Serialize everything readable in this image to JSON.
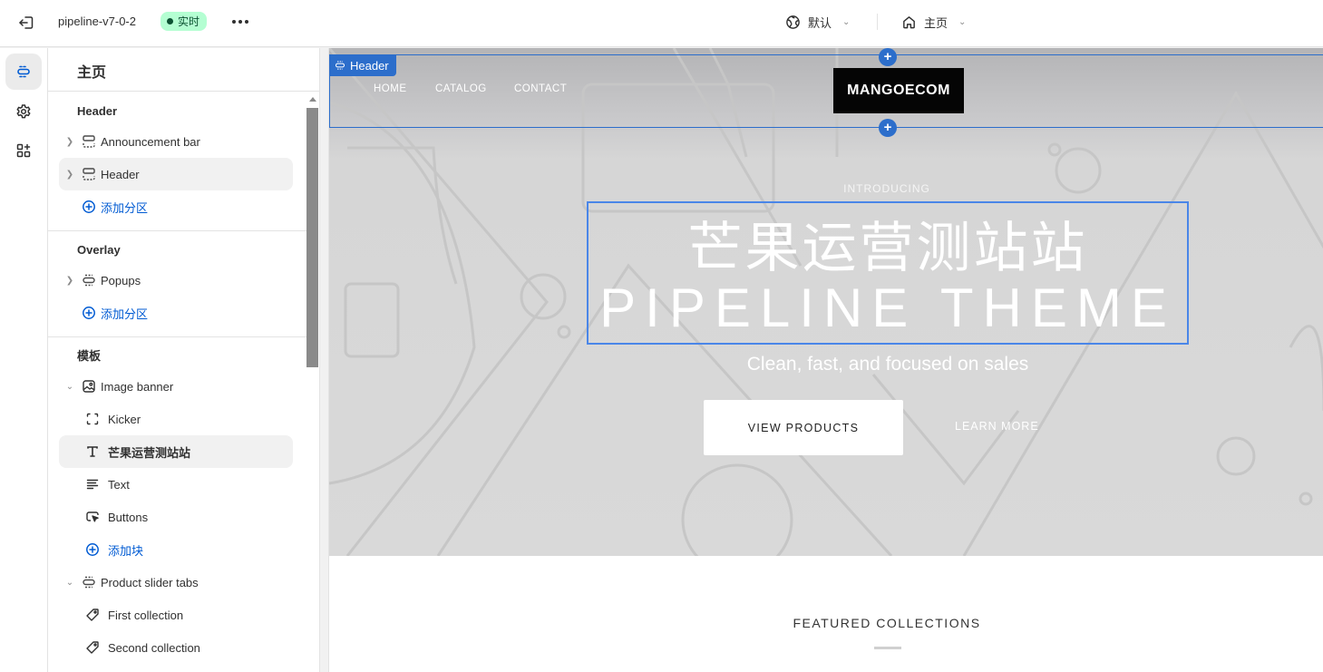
{
  "topbar": {
    "exit_icon": "exit-icon",
    "theme_name": "pipeline-v7-0-2",
    "status_badge": "实时",
    "more_icon": "more-horizontal-icon",
    "language_selector": {
      "icon": "globe-icon",
      "value": "默认"
    },
    "page_selector": {
      "icon": "home-icon",
      "value": "主页"
    }
  },
  "rail": {
    "items": [
      {
        "name": "sections",
        "icon": "sections-icon",
        "active": true
      },
      {
        "name": "theme-settings",
        "icon": "gear-icon",
        "active": false
      },
      {
        "name": "apps",
        "icon": "apps-add-icon",
        "active": false
      }
    ]
  },
  "sidebar": {
    "title": "主页",
    "groups": [
      {
        "heading": "Header",
        "items": [
          {
            "label": "Announcement bar",
            "icon": "section-icon",
            "expandable": true,
            "selected": false
          },
          {
            "label": "Header",
            "icon": "section-icon",
            "expandable": true,
            "selected": true
          }
        ],
        "add_label": "添加分区"
      },
      {
        "heading": "Overlay",
        "items": [
          {
            "label": "Popups",
            "icon": "section-icon",
            "expandable": true,
            "selected": false
          }
        ],
        "add_label": "添加分区"
      },
      {
        "heading": "模板",
        "sections": [
          {
            "label": "Image banner",
            "icon": "image-icon",
            "expanded": true,
            "blocks": [
              {
                "label": "Kicker",
                "icon": "dashed-square-icon",
                "selected": false
              },
              {
                "label": "芒果运营测站站",
                "icon": "text-type-icon",
                "selected": true
              },
              {
                "label": "Text",
                "icon": "text-align-icon",
                "selected": false
              },
              {
                "label": "Buttons",
                "icon": "button-pointer-icon",
                "selected": false
              }
            ],
            "add_block_label": "添加块"
          },
          {
            "label": "Product slider tabs",
            "icon": "section-icon",
            "expanded": true,
            "blocks": [
              {
                "label": "First collection",
                "icon": "tag-icon",
                "selected": false
              },
              {
                "label": "Second collection",
                "icon": "tag-icon",
                "selected": false
              }
            ]
          }
        ]
      }
    ]
  },
  "preview": {
    "header_tag": "Header",
    "nav": [
      "HOME",
      "CATALOG",
      "CONTACT"
    ],
    "logo": "MANGOECOM",
    "hero": {
      "kicker": "INTRODUCING",
      "heading_line1": "芒果运营测站站",
      "heading_line2": "PIPELINE THEME",
      "subheading": "Clean, fast, and focused on sales",
      "primary_button": "VIEW PRODUCTS",
      "secondary_button": "LEARN MORE"
    },
    "featured_title": "FEATURED COLLECTIONS"
  },
  "colors": {
    "accent": "#2c6ecb",
    "link": "#005bd3",
    "live_badge_bg": "#b4fed2",
    "live_badge_text": "#0c5132",
    "logo_bg": "#050505"
  }
}
